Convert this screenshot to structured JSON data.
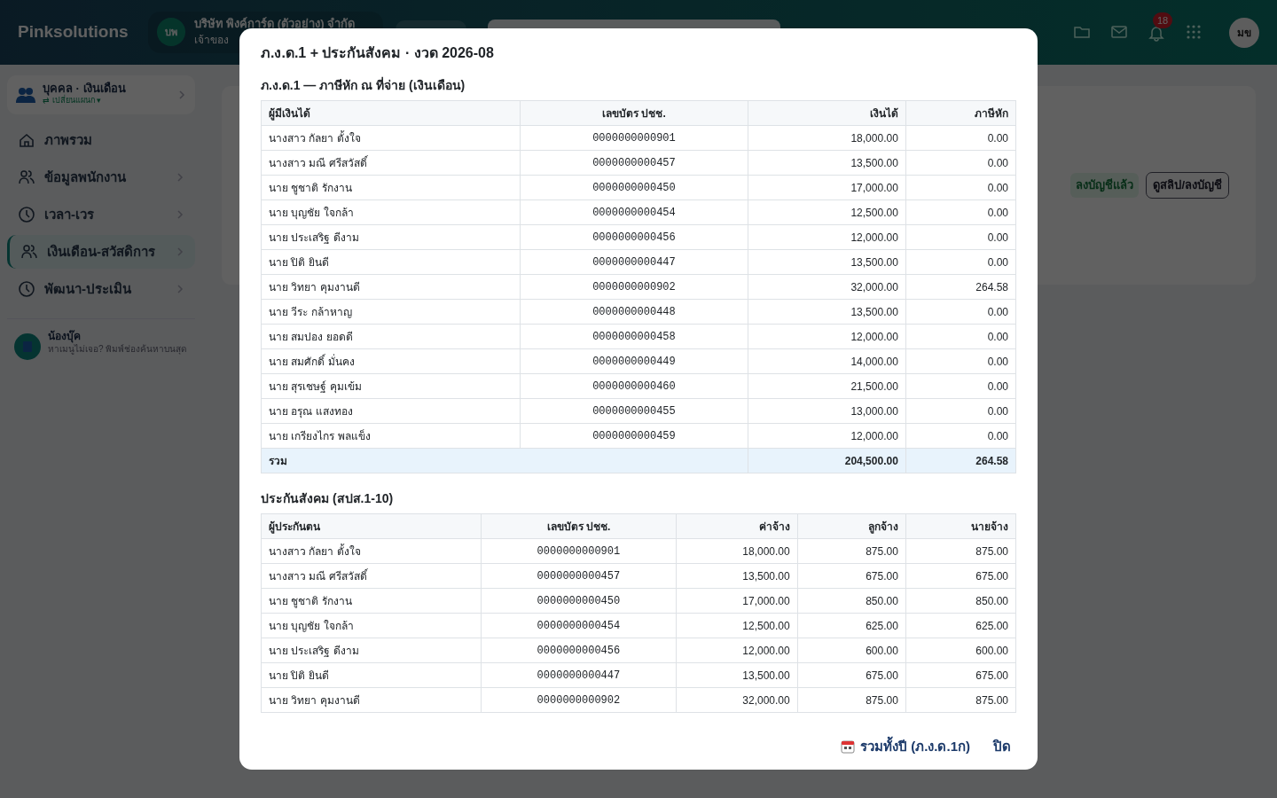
{
  "app": {
    "brand": "Pinksolutions",
    "company": {
      "initials": "บพ",
      "name": "บริษัท พิงค์การ์ด (ตัวอย่าง) จำกัด",
      "role": "เจ้าของ"
    },
    "notifications": "18",
    "user_initials": "มข",
    "module": {
      "title": "บุคคล · เงินเดือน",
      "switch": "⇄ เปลี่ยนแผนก ▾"
    },
    "nav": [
      {
        "label": "ภาพรวม",
        "selected": false,
        "chevron": false
      },
      {
        "label": "ข้อมูลพนักงาน",
        "selected": false,
        "chevron": true
      },
      {
        "label": "เวลา-เวร",
        "selected": false,
        "chevron": true
      },
      {
        "label": "เงินเดือน-สวัสดิการ",
        "selected": true,
        "chevron": true
      },
      {
        "label": "พัฒนา-ประเมิน",
        "selected": false,
        "chevron": true
      }
    ],
    "assistant": {
      "name": "น้องบุ๊ค",
      "hint": "หาเมนูไม่เจอ? พิมพ์ช่องค้นหาบนสุด"
    },
    "status_badge": "ลงบัญชีแล้ว",
    "slip_button": "ดูสลิป/ลงบัญชี"
  },
  "modal": {
    "title": "ภ.ง.ด.1 + ประกันสังคม · งวด 2026-08",
    "pnd1": {
      "heading": "ภ.ง.ด.1 — ภาษีหัก ณ ที่จ่าย (เงินเดือน)",
      "columns": [
        "ผู้มีเงินได้",
        "เลขบัตร ปชช.",
        "เงินได้",
        "ภาษีหัก"
      ],
      "rows": [
        [
          "นางสาว กัลยา ตั้งใจ",
          "0000000000901",
          "18,000.00",
          "0.00"
        ],
        [
          "นางสาว มณี ศรีสวัสดิ์",
          "0000000000457",
          "13,500.00",
          "0.00"
        ],
        [
          "นาย ชูชาติ รักงาน",
          "0000000000450",
          "17,000.00",
          "0.00"
        ],
        [
          "นาย บุญชัย ใจกล้า",
          "0000000000454",
          "12,500.00",
          "0.00"
        ],
        [
          "นาย ประเสริฐ ดีงาม",
          "0000000000456",
          "12,000.00",
          "0.00"
        ],
        [
          "นาย ปิติ ยินดี",
          "0000000000447",
          "13,500.00",
          "0.00"
        ],
        [
          "นาย วิทยา คุมงานดี",
          "0000000000902",
          "32,000.00",
          "264.58"
        ],
        [
          "นาย วีระ กล้าหาญ",
          "0000000000448",
          "13,500.00",
          "0.00"
        ],
        [
          "นาย สมปอง ยอดดี",
          "0000000000458",
          "12,000.00",
          "0.00"
        ],
        [
          "นาย สมศักดิ์ มั่นคง",
          "0000000000449",
          "14,000.00",
          "0.00"
        ],
        [
          "นาย สุรเชษฐ์ คุมเข้ม",
          "0000000000460",
          "21,500.00",
          "0.00"
        ],
        [
          "นาย อรุณ แสงทอง",
          "0000000000455",
          "13,000.00",
          "0.00"
        ],
        [
          "นาย เกรียงไกร พลแข็ง",
          "0000000000459",
          "12,000.00",
          "0.00"
        ]
      ],
      "total": {
        "label": "รวม",
        "income": "204,500.00",
        "tax": "264.58"
      }
    },
    "sso": {
      "heading": "ประกันสังคม (สปส.1-10)",
      "columns": [
        "ผู้ประกันตน",
        "เลขบัตร ปชช.",
        "ค่าจ้าง",
        "ลูกจ้าง",
        "นายจ้าง"
      ],
      "rows": [
        [
          "นางสาว กัลยา ตั้งใจ",
          "0000000000901",
          "18,000.00",
          "875.00",
          "875.00"
        ],
        [
          "นางสาว มณี ศรีสวัสดิ์",
          "0000000000457",
          "13,500.00",
          "675.00",
          "675.00"
        ],
        [
          "นาย ชูชาติ รักงาน",
          "0000000000450",
          "17,000.00",
          "850.00",
          "850.00"
        ],
        [
          "นาย บุญชัย ใจกล้า",
          "0000000000454",
          "12,500.00",
          "625.00",
          "625.00"
        ],
        [
          "นาย ประเสริฐ ดีงาม",
          "0000000000456",
          "12,000.00",
          "600.00",
          "600.00"
        ],
        [
          "นาย ปิติ ยินดี",
          "0000000000447",
          "13,500.00",
          "675.00",
          "675.00"
        ],
        [
          "นาย วิทยา คุมงานดี",
          "0000000000902",
          "32,000.00",
          "875.00",
          "875.00"
        ]
      ]
    },
    "year_button": "รวมทั้งปี (ภ.ง.ด.1ก)",
    "close_button": "ปิด"
  }
}
